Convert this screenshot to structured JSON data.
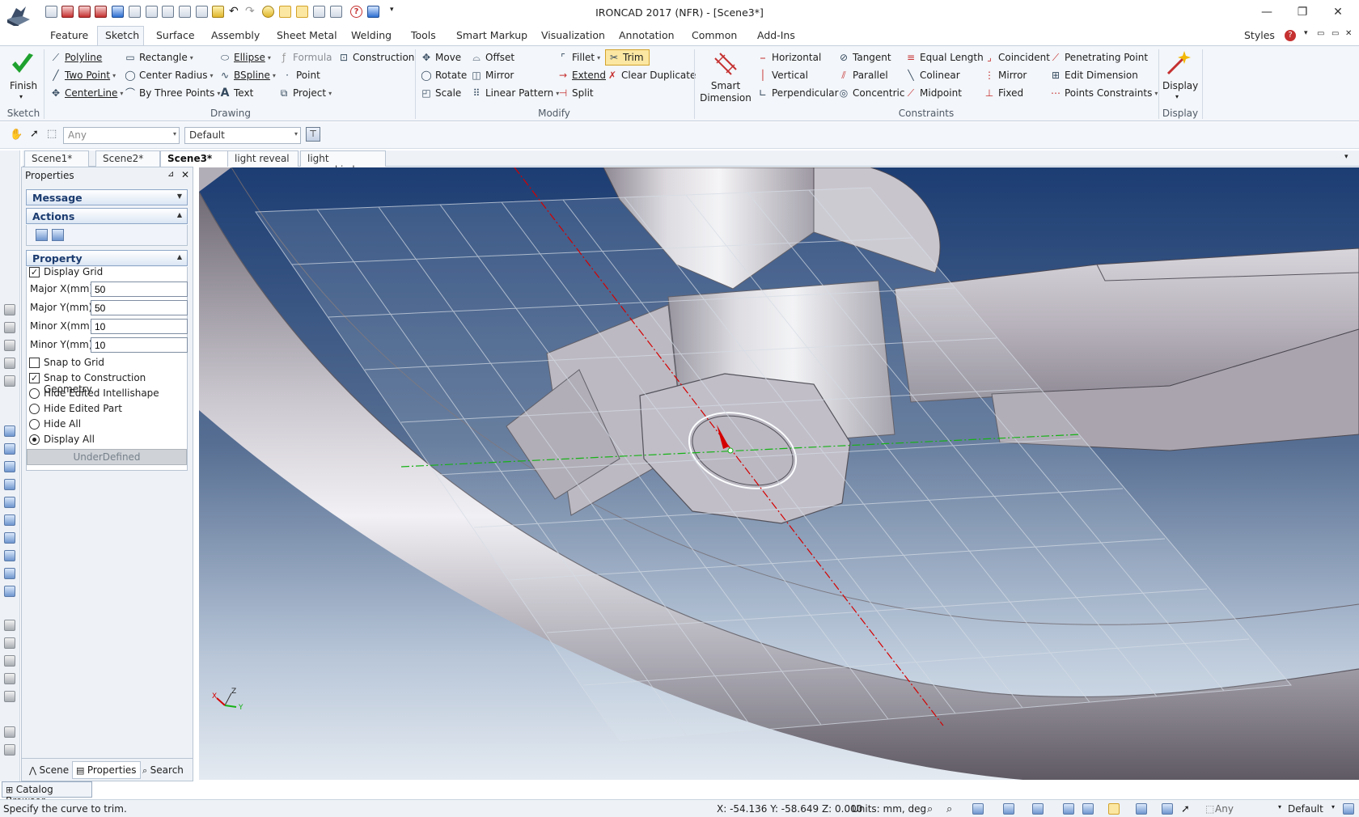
{
  "window": {
    "title": "IRONCAD 2017 (NFR) - [Scene3*]",
    "minimize": "—",
    "restore": "❐",
    "close": "✕"
  },
  "ribbon_tabs": [
    "Feature",
    "Sketch",
    "Surface",
    "Assembly",
    "Sheet Metal",
    "Welding",
    "Tools",
    "Smart Markup",
    "Visualization",
    "Annotation",
    "Common",
    "Add-Ins"
  ],
  "styles_label": "Styles",
  "ribbon": {
    "finish": "Finish",
    "groups": {
      "sketch": "Sketch",
      "drawing": "Drawing",
      "modify": "Modify",
      "constraints": "Constraints",
      "display": "Display"
    },
    "drawing": {
      "polyline": "Polyline",
      "rectangle": "Rectangle",
      "ellipse": "Ellipse",
      "formula": "Formula",
      "construction": "Construction",
      "two_point": "Two Point",
      "center_radius": "Center Radius",
      "bspline": "BSpline",
      "point": "Point",
      "centerline": "CenterLine",
      "by_three_points": "By Three Points",
      "text": "Text",
      "project": "Project"
    },
    "modify": {
      "move": "Move",
      "offset": "Offset",
      "fillet": "Fillet",
      "trim": "Trim",
      "rotate": "Rotate",
      "mirror": "Mirror",
      "extend": "Extend",
      "clear_duplicate": "Clear Duplicate",
      "scale": "Scale",
      "linear_pattern": "Linear Pattern",
      "split": "Split"
    },
    "smart_dimension_1": "Smart",
    "smart_dimension_2": "Dimension",
    "constraints": {
      "horizontal": "Horizontal",
      "tangent": "Tangent",
      "equal_length": "Equal Length",
      "coincident": "Coincident",
      "penetrating_point": "Penetrating Point",
      "vertical": "Vertical",
      "parallel": "Parallel",
      "colinear": "Colinear",
      "mirror": "Mirror",
      "edit_dimension": "Edit Dimension",
      "perpendicular": "Perpendicular",
      "concentric": "Concentric",
      "midpoint": "Midpoint",
      "fixed": "Fixed",
      "points_constraints": "Points Constraints"
    },
    "display": "Display"
  },
  "toolbar": {
    "filter_value": "Any",
    "style_value": "Default"
  },
  "doc_tabs": [
    {
      "label": "Scene1*",
      "active": false
    },
    {
      "label": "Scene2*",
      "active": false
    },
    {
      "label": "Scene3*",
      "active": true
    },
    {
      "label": "light reveal",
      "active": false
    },
    {
      "label": "light reveal.icd",
      "active": false
    }
  ],
  "doc_tab_close": "✕",
  "properties": {
    "header": "Properties",
    "message": "Message",
    "actions": "Actions",
    "property": "Property",
    "display_grid": "Display Grid",
    "major_x_label": "Major X(mm)",
    "major_x": "50",
    "major_y_label": "Major Y(mm)",
    "major_y": "50",
    "minor_x_label": "Minor X(mm)",
    "minor_x": "10",
    "minor_y_label": "Minor Y(mm)",
    "minor_y": "10",
    "snap_to_grid": "Snap to Grid",
    "snap_construction": "Snap to Construction Geometry",
    "hide_intellishape": "Hide Edited Intellishape",
    "hide_part": "Hide Edited Part",
    "hide_all": "Hide All",
    "display_all": "Display All",
    "status": "UnderDefined",
    "check_mark": "✓"
  },
  "bottom_tabs": {
    "scene": "Scene",
    "properties": "Properties",
    "search": "Search"
  },
  "triad": {
    "x": "X",
    "y": "Y",
    "z": "Z"
  },
  "catalog_browser": "Catalog Browser",
  "status": {
    "prompt": "Specify the curve to trim.",
    "coords": "X: -54.136 Y: -58.649 Z: 0.000",
    "units": "Units: mm, deg",
    "filter": "Any",
    "style": "Default"
  },
  "colors": {
    "accent": "#2b579a",
    "axis_red": "#d40000",
    "axis_green": "#17b217",
    "trim_highlight": "#fbe7a2"
  }
}
